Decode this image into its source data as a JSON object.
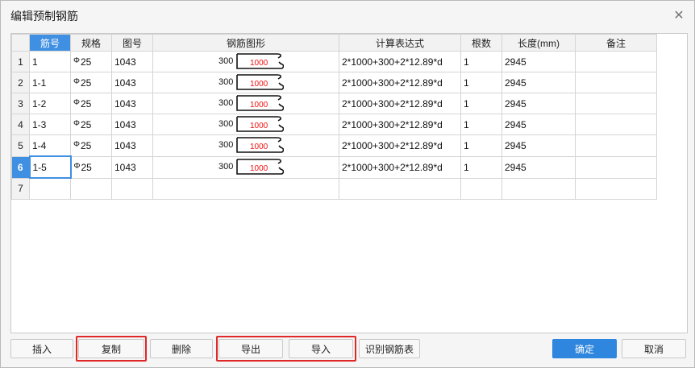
{
  "window": {
    "title": "编辑预制钢筋",
    "close_glyph": "✕"
  },
  "table": {
    "headers": [
      "筋号",
      "规格",
      "图号",
      "钢筋图形",
      "计算表达式",
      "根数",
      "长度(mm)",
      "备注"
    ],
    "rows": [
      {
        "n": "1",
        "bar": "1",
        "spec": "25",
        "fig": "1043",
        "len_left": "300",
        "len_mid": "1000",
        "expr": "2*1000+300+2*12.89*d",
        "count": "1",
        "length": "2945",
        "note": ""
      },
      {
        "n": "2",
        "bar": "1-1",
        "spec": "25",
        "fig": "1043",
        "len_left": "300",
        "len_mid": "1000",
        "expr": "2*1000+300+2*12.89*d",
        "count": "1",
        "length": "2945",
        "note": ""
      },
      {
        "n": "3",
        "bar": "1-2",
        "spec": "25",
        "fig": "1043",
        "len_left": "300",
        "len_mid": "1000",
        "expr": "2*1000+300+2*12.89*d",
        "count": "1",
        "length": "2945",
        "note": ""
      },
      {
        "n": "4",
        "bar": "1-3",
        "spec": "25",
        "fig": "1043",
        "len_left": "300",
        "len_mid": "1000",
        "expr": "2*1000+300+2*12.89*d",
        "count": "1",
        "length": "2945",
        "note": ""
      },
      {
        "n": "5",
        "bar": "1-4",
        "spec": "25",
        "fig": "1043",
        "len_left": "300",
        "len_mid": "1000",
        "expr": "2*1000+300+2*12.89*d",
        "count": "1",
        "length": "2945",
        "note": ""
      },
      {
        "n": "6",
        "bar": "1-5",
        "spec": "25",
        "fig": "1043",
        "len_left": "300",
        "len_mid": "1000",
        "expr": "2*1000+300+2*12.89*d",
        "count": "1",
        "length": "2945",
        "note": ""
      },
      {
        "n": "7",
        "bar": "",
        "spec": "",
        "fig": "",
        "len_left": "",
        "len_mid": "",
        "expr": "",
        "count": "",
        "length": "",
        "note": ""
      }
    ],
    "steel_symbol": "Φ"
  },
  "buttons": {
    "insert": "插入",
    "copy": "复制",
    "delete": "删除",
    "export": "导出",
    "import": "导入",
    "recognize": "识别钢筋表",
    "ok": "确定",
    "cancel": "取消"
  },
  "colors": {
    "accent": "#3f8fe2",
    "highlight": "#e02828",
    "dimension_text": "#ee1111"
  }
}
